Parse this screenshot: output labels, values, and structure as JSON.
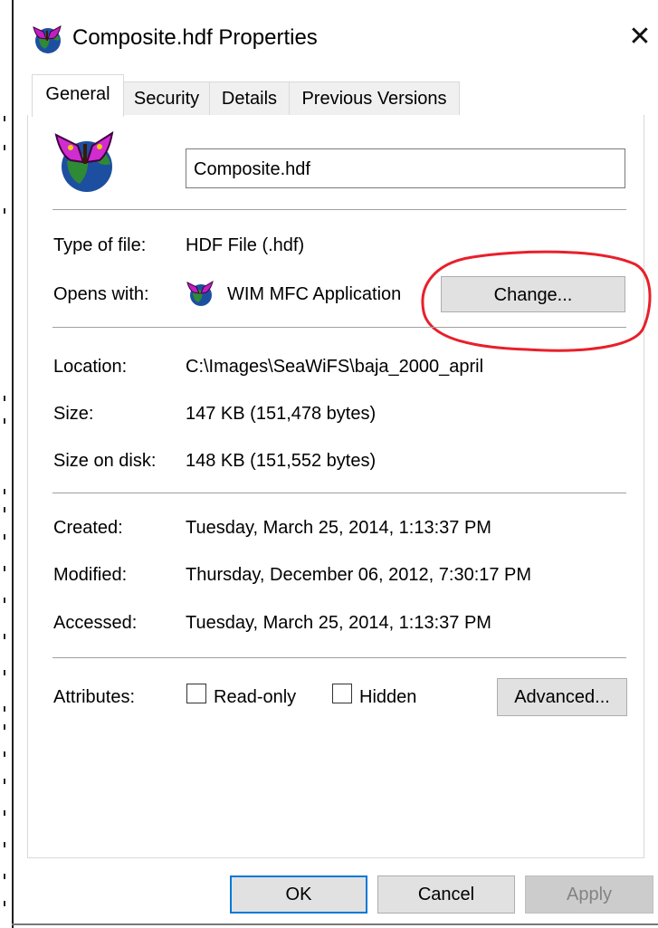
{
  "window": {
    "title": "Composite.hdf Properties",
    "close_glyph": "✕",
    "icon": "butterfly-globe-icon"
  },
  "tabs": [
    {
      "label": "General",
      "active": true
    },
    {
      "label": "Security",
      "active": false
    },
    {
      "label": "Details",
      "active": false
    },
    {
      "label": "Previous Versions",
      "active": false
    }
  ],
  "general": {
    "file_name": "Composite.hdf",
    "type_label": "Type of file:",
    "type_value": "HDF File (.hdf)",
    "opens_label": "Opens with:",
    "opens_value": "WIM MFC Application",
    "change_label": "Change...",
    "location_label": "Location:",
    "location_value": "C:\\Images\\SeaWiFS\\baja_2000_april",
    "size_label": "Size:",
    "size_value": "147 KB (151,478 bytes)",
    "size_on_disk_label": "Size on disk:",
    "size_on_disk_value": "148 KB (151,552 bytes)",
    "created_label": "Created:",
    "created_value": "Tuesday, March 25, 2014, 1:13:37 PM",
    "modified_label": "Modified:",
    "modified_value": "Thursday, December 06, 2012, 7:30:17 PM",
    "accessed_label": "Accessed:",
    "accessed_value": "Tuesday, March 25, 2014, 1:13:37 PM",
    "attributes_label": "Attributes:",
    "readonly_label": "Read-only",
    "readonly_checked": false,
    "hidden_label": "Hidden",
    "hidden_checked": false,
    "advanced_label": "Advanced..."
  },
  "footer": {
    "ok_label": "OK",
    "cancel_label": "Cancel",
    "apply_label": "Apply",
    "apply_enabled": false
  },
  "colors": {
    "focus_border": "#0078d7",
    "annotation": "#e8202a"
  }
}
